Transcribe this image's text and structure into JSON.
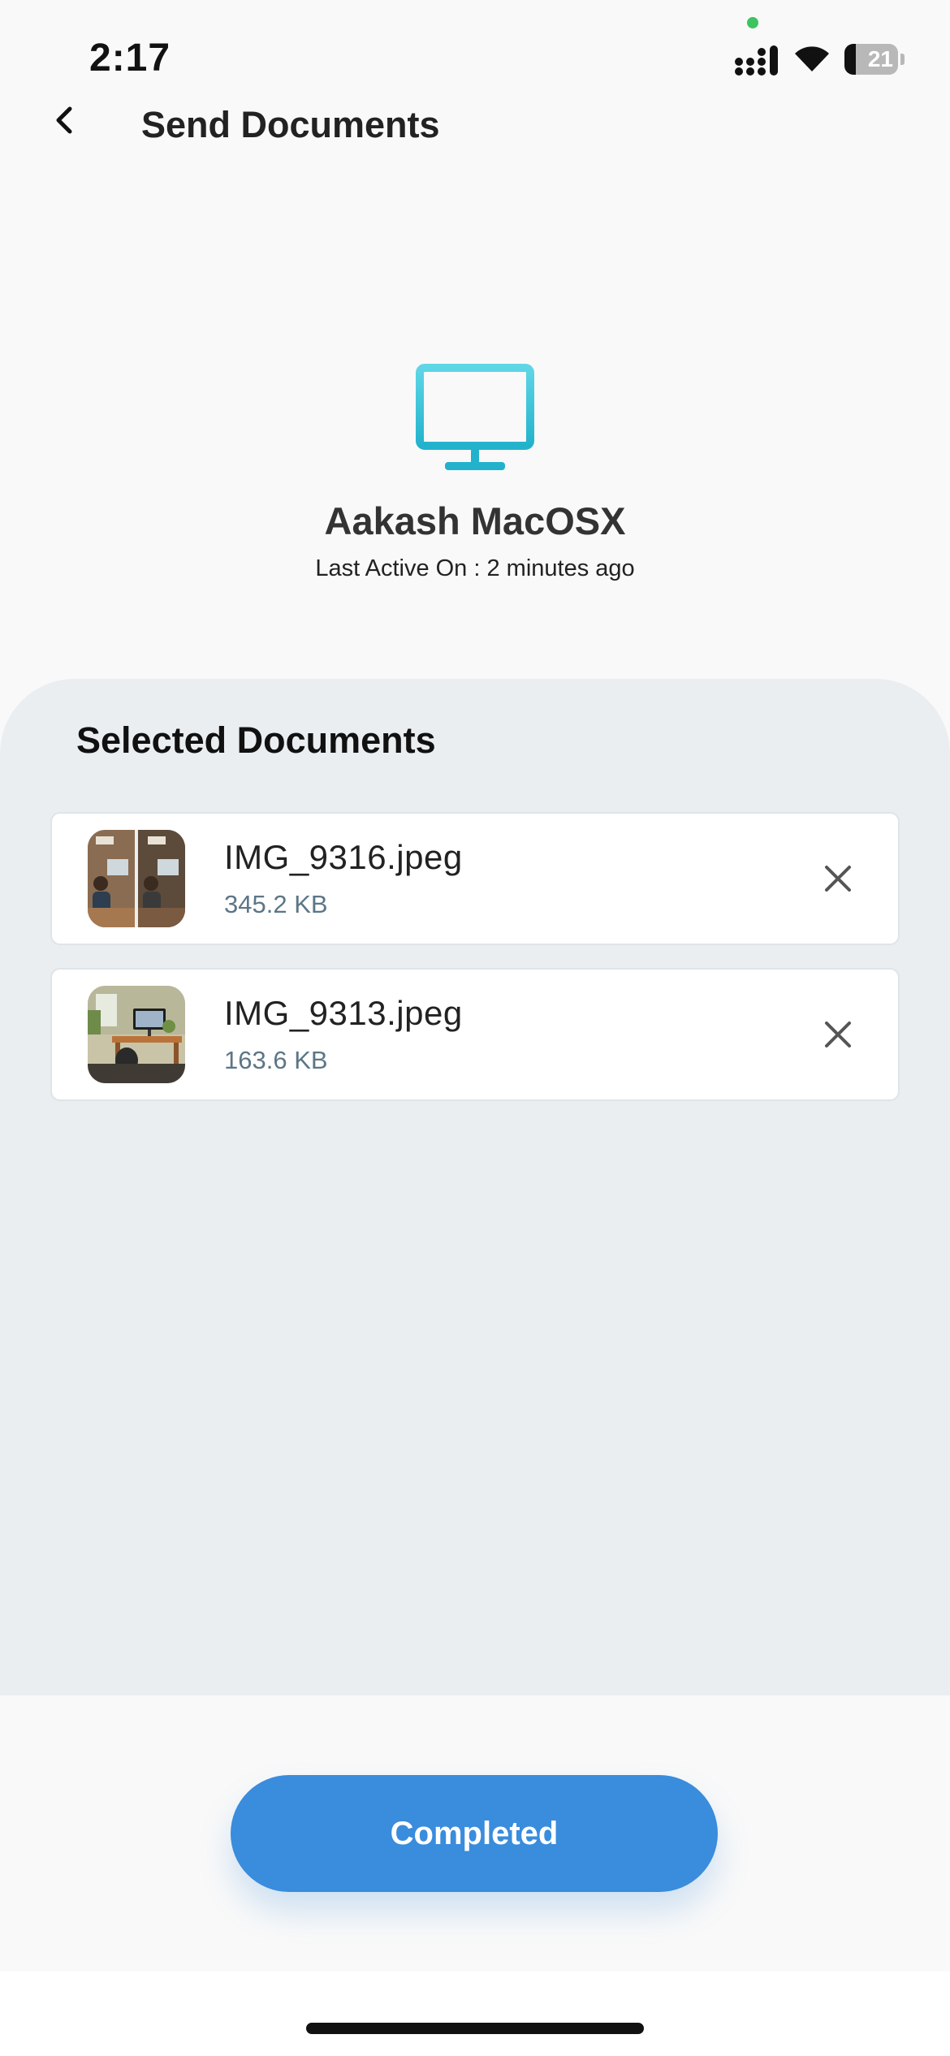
{
  "status_bar": {
    "time": "2:17",
    "battery_level": "21",
    "battery_fraction": 0.21
  },
  "nav": {
    "back_icon": "chevron-left-icon",
    "title": "Send Documents"
  },
  "device": {
    "icon": "monitor-icon",
    "icon_color": "#2bbad3",
    "name": "Aakash MacOSX",
    "last_active": "Last Active On : 2 minutes ago"
  },
  "documents": {
    "title": "Selected Documents",
    "items": [
      {
        "name": "IMG_9316.jpeg",
        "size": "345.2 KB",
        "remove_icon": "close-icon"
      },
      {
        "name": "IMG_9313.jpeg",
        "size": "163.6 KB",
        "remove_icon": "close-icon"
      }
    ]
  },
  "actions": {
    "completed_label": "Completed",
    "accent_color": "#3a8cdc"
  }
}
